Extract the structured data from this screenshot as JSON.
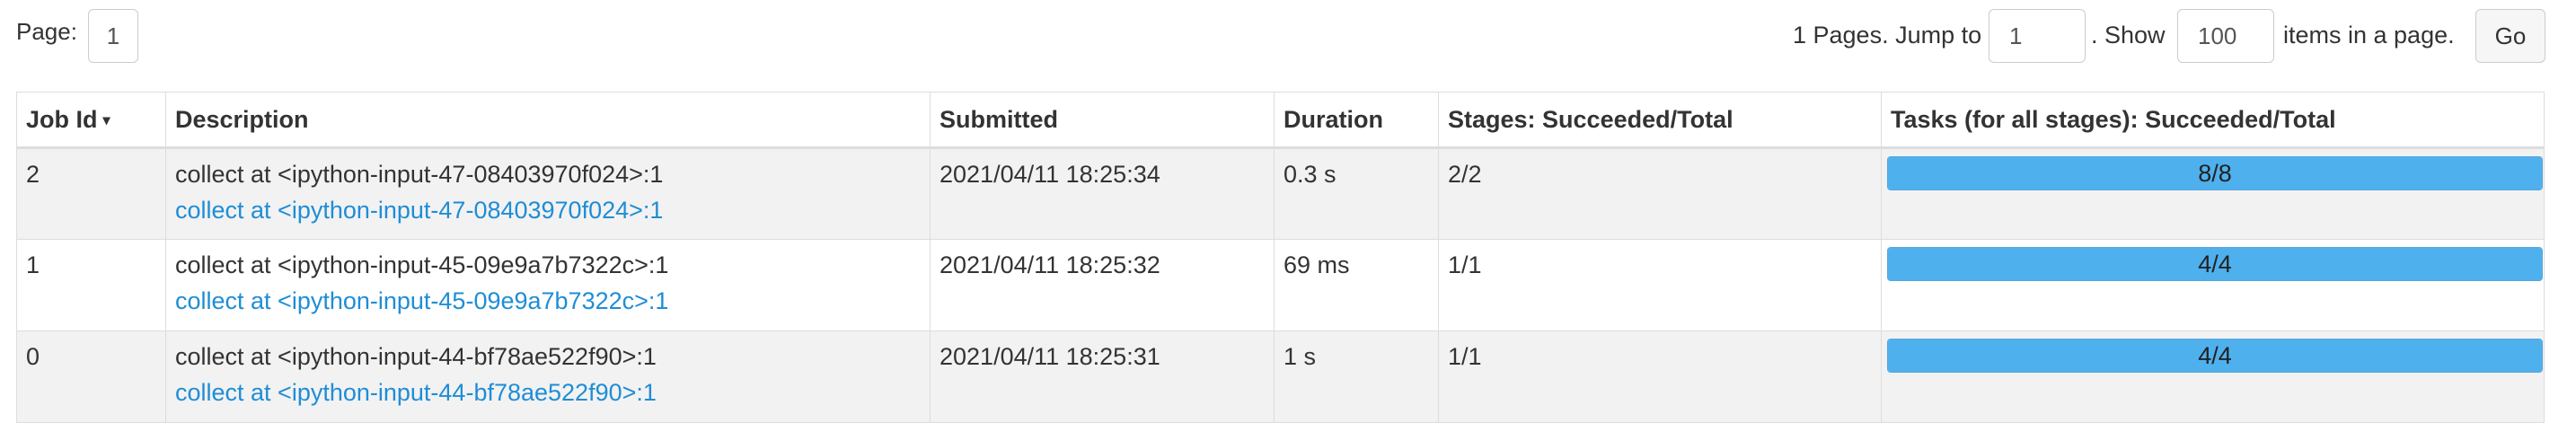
{
  "pagination": {
    "page_label": "Page:",
    "page_value": "1",
    "pages_text": "1 Pages. Jump to",
    "jump_value": "1",
    "show_text": ". Show",
    "show_value": "100",
    "items_text": "items in a page.",
    "go_label": "Go"
  },
  "table": {
    "headers": {
      "job_id": "Job Id",
      "sort_icon": "▾",
      "description": "Description",
      "submitted": "Submitted",
      "duration": "Duration",
      "stages": "Stages: Succeeded/Total",
      "tasks": "Tasks (for all stages): Succeeded/Total"
    },
    "rows": [
      {
        "job_id": "2",
        "description": "collect at <ipython-input-47-08403970f024>:1",
        "description_link": "collect at <ipython-input-47-08403970f024>:1",
        "submitted": "2021/04/11 18:25:34",
        "duration": "0.3 s",
        "stages": "2/2",
        "tasks": "8/8",
        "tasks_progress": 1.0
      },
      {
        "job_id": "1",
        "description": "collect at <ipython-input-45-09e9a7b7322c>:1",
        "description_link": "collect at <ipython-input-45-09e9a7b7322c>:1",
        "submitted": "2021/04/11 18:25:32",
        "duration": "69 ms",
        "stages": "1/1",
        "tasks": "4/4",
        "tasks_progress": 1.0
      },
      {
        "job_id": "0",
        "description": "collect at <ipython-input-44-bf78ae522f90>:1",
        "description_link": "collect at <ipython-input-44-bf78ae522f90>:1",
        "submitted": "2021/04/11 18:25:31",
        "duration": "1 s",
        "stages": "1/1",
        "tasks": "4/4",
        "tasks_progress": 1.0
      }
    ]
  },
  "colors": {
    "link": "#1f8dd6",
    "progress_fill": "#4fb0ee",
    "row_stripe": "#f2f2f2"
  }
}
